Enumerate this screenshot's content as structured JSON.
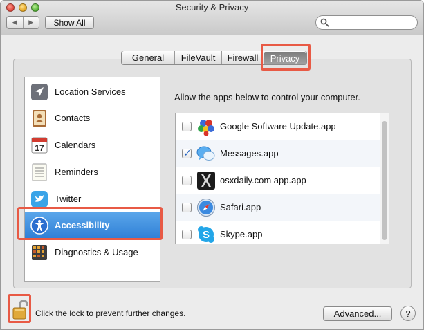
{
  "window": {
    "title": "Security & Privacy"
  },
  "toolbar": {
    "back_glyph": "◀",
    "forward_glyph": "▶",
    "show_all_label": "Show All",
    "search_placeholder": ""
  },
  "tabs": [
    {
      "label": "General",
      "selected": false
    },
    {
      "label": "FileVault",
      "selected": false
    },
    {
      "label": "Firewall",
      "selected": false
    },
    {
      "label": "Privacy",
      "selected": true
    }
  ],
  "sidebar": {
    "items": [
      {
        "label": "Location Services",
        "icon": "location-arrow-icon",
        "selected": false
      },
      {
        "label": "Contacts",
        "icon": "contacts-book-icon",
        "selected": false
      },
      {
        "label": "Calendars",
        "icon": "calendar-icon",
        "selected": false
      },
      {
        "label": "Reminders",
        "icon": "reminders-list-icon",
        "selected": false
      },
      {
        "label": "Twitter",
        "icon": "twitter-bird-icon",
        "selected": false
      },
      {
        "label": "Accessibility",
        "icon": "accessibility-person-icon",
        "selected": true
      },
      {
        "label": "Diagnostics & Usage",
        "icon": "diagnostics-grid-icon",
        "selected": false
      }
    ]
  },
  "main": {
    "description": "Allow the apps below to control your computer.",
    "apps": [
      {
        "label": "Google Software Update.app",
        "icon": "google-software-update-icon",
        "checked": false
      },
      {
        "label": "Messages.app",
        "icon": "messages-bubble-icon",
        "checked": true
      },
      {
        "label": "osxdaily.com app.app",
        "icon": "osxdaily-x-icon",
        "checked": false
      },
      {
        "label": "Safari.app",
        "icon": "safari-compass-icon",
        "checked": false
      },
      {
        "label": "Skype.app",
        "icon": "skype-icon",
        "checked": false
      }
    ]
  },
  "footer": {
    "lock_text": "Click the lock to prevent further changes.",
    "advanced_label": "Advanced...",
    "help_glyph": "?"
  },
  "colors": {
    "highlight_red": "#e85a45",
    "selection_blue": "#2f7fd6"
  }
}
